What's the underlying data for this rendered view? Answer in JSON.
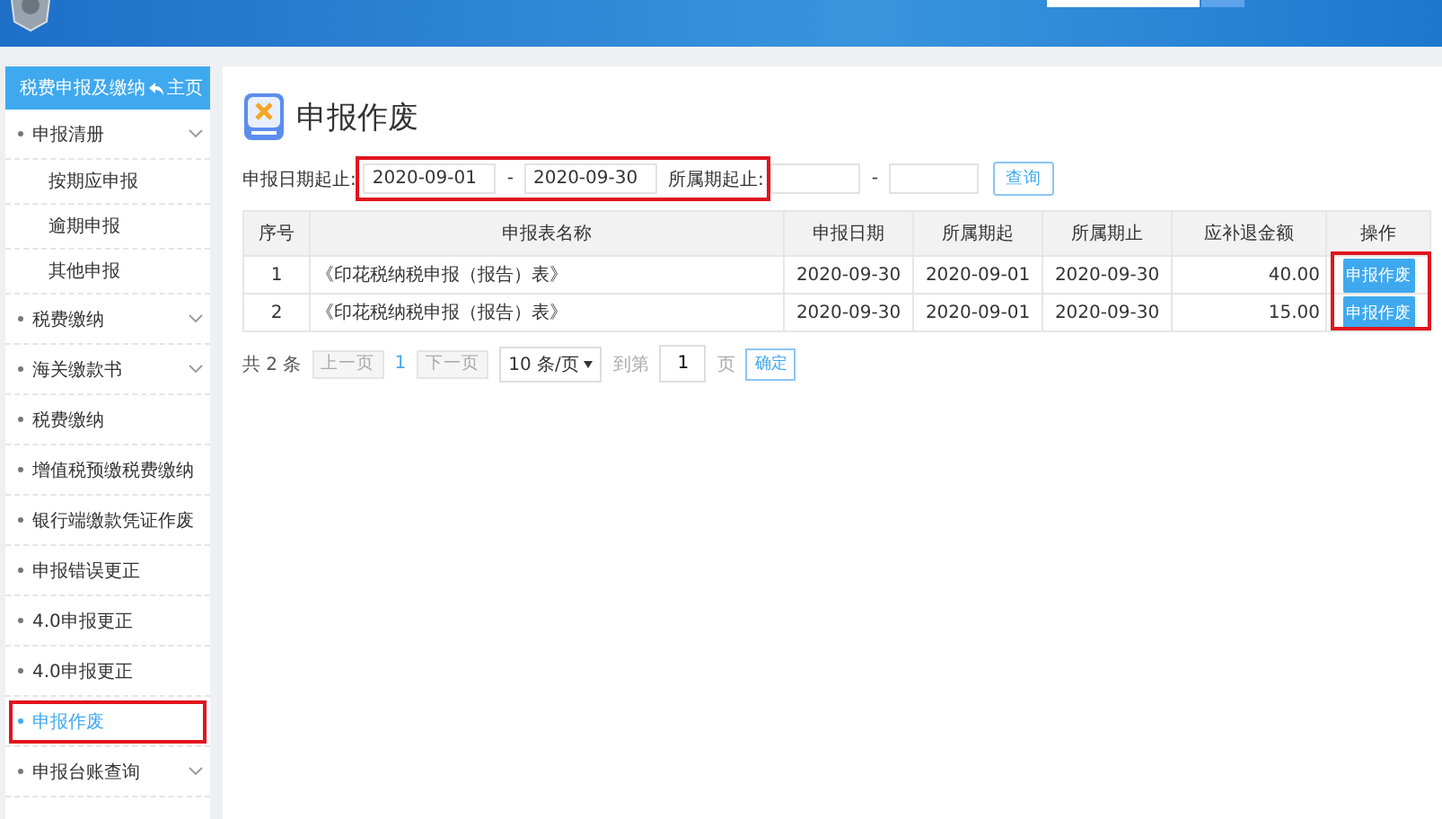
{
  "sidebar": {
    "title": "税费申报及缴纳",
    "home_link": "主页",
    "items": [
      {
        "label": "申报清册",
        "expandable": true,
        "selected": false,
        "highlighted": false,
        "children": [
          {
            "label": "按期应申报",
            "selected": false
          },
          {
            "label": "逾期申报",
            "selected": false
          },
          {
            "label": "其他申报",
            "selected": false
          }
        ]
      },
      {
        "label": "税费缴纳",
        "expandable": true,
        "selected": false,
        "highlighted": false
      },
      {
        "label": "海关缴款书",
        "expandable": true,
        "selected": false,
        "highlighted": false
      },
      {
        "label": "税费缴纳",
        "expandable": false,
        "selected": false,
        "highlighted": false
      },
      {
        "label": "增值税预缴税费缴纳",
        "expandable": false,
        "selected": false,
        "highlighted": false
      },
      {
        "label": "银行端缴款凭证作废",
        "expandable": false,
        "selected": false,
        "highlighted": false
      },
      {
        "label": "申报错误更正",
        "expandable": false,
        "selected": false,
        "highlighted": false
      },
      {
        "label": "4.0申报更正",
        "expandable": false,
        "selected": false,
        "highlighted": false
      },
      {
        "label": "4.0申报更正",
        "expandable": false,
        "selected": false,
        "highlighted": false
      },
      {
        "label": "申报作废",
        "expandable": false,
        "selected": true,
        "highlighted": true
      },
      {
        "label": "申报台账查询",
        "expandable": true,
        "selected": false,
        "highlighted": false
      }
    ]
  },
  "page": {
    "title": "申报作废"
  },
  "filters": {
    "date_label": "申报日期起止:",
    "date_from": "2020-09-01",
    "date_to": "2020-09-30",
    "period_label": "所属期起止:",
    "separator": "-",
    "query_button": "查询",
    "highlighted": true
  },
  "table": {
    "columns": [
      "序号",
      "申报表名称",
      "申报日期",
      "所属期起",
      "所属期止",
      "应补退金额",
      "操作"
    ],
    "action_column_highlighted": true,
    "rows": [
      {
        "index": "1",
        "name": "《印花税纳税申报（报告）表》",
        "date": "2020-09-30",
        "period_from": "2020-09-01",
        "period_to": "2020-09-30",
        "amount": "40.00",
        "action": "申报作废"
      },
      {
        "index": "2",
        "name": "《印花税纳税申报（报告）表》",
        "date": "2020-09-30",
        "period_from": "2020-09-01",
        "period_to": "2020-09-30",
        "amount": "15.00",
        "action": "申报作废"
      }
    ]
  },
  "pagination": {
    "total": "共 2 条",
    "prev": "上一页",
    "current": "1",
    "next": "下一页",
    "page_size": "10 条/页",
    "goto_label": "到第",
    "goto_value": "1",
    "page_unit": "页",
    "confirm": "确定"
  }
}
